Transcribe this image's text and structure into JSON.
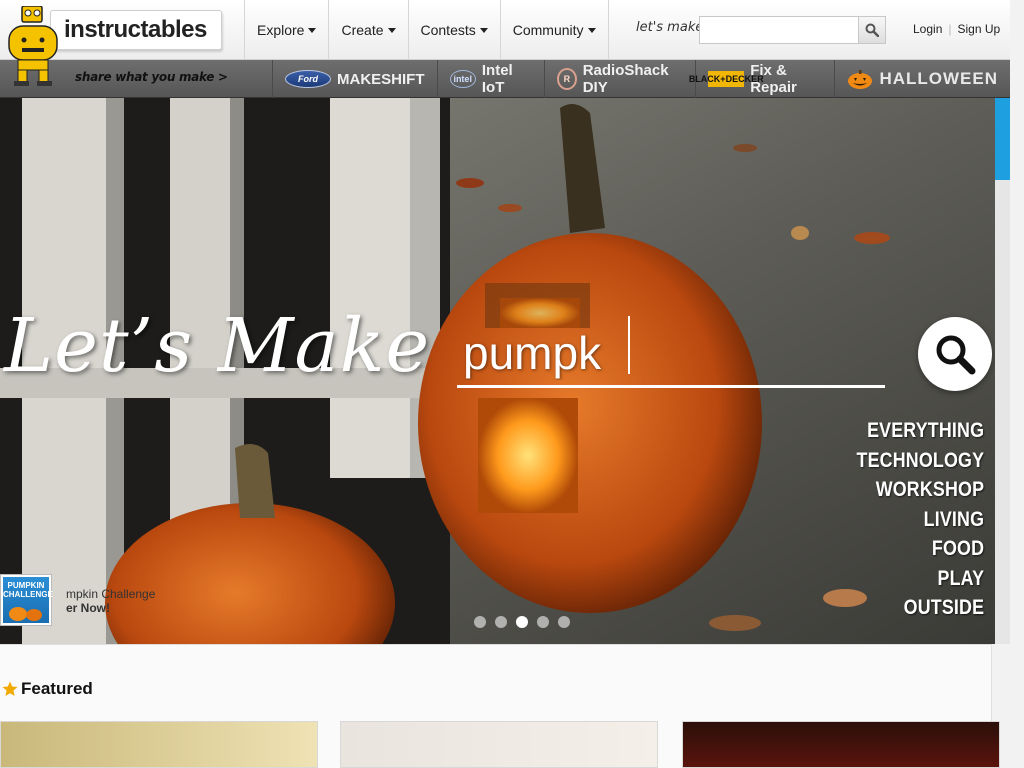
{
  "header": {
    "logo_text": "instructables",
    "tagline": "share what you make >",
    "nav": [
      {
        "label": "Explore"
      },
      {
        "label": "Create"
      },
      {
        "label": "Contests"
      },
      {
        "label": "Community"
      }
    ],
    "search_label": "let's make",
    "search_value": "",
    "login": "Login",
    "signup": "Sign Up"
  },
  "channels": [
    {
      "badge": "Ford",
      "label": "MAKESHIFT"
    },
    {
      "badge": "intel",
      "label": "Intel IoT"
    },
    {
      "badge": "R",
      "label": "RadioShack DIY"
    },
    {
      "badge": "BLACK+DECKER",
      "label": "Fix & Repair"
    },
    {
      "badge": "pumpkin",
      "label": "HALLOWEEN"
    }
  ],
  "hero": {
    "title": "Let’s Make",
    "search_value": "pumpk",
    "categories": [
      "EVERYTHING",
      "TECHNOLOGY",
      "WORKSHOP",
      "LIVING",
      "FOOD",
      "PLAY",
      "OUTSIDE"
    ],
    "contest": {
      "badge_line1": "PUMPKIN",
      "badge_line2": "CHALLENGE",
      "text_line1": "mpkin Challenge",
      "text_line2": "er Now!"
    },
    "carousel_count": 5,
    "carousel_active": 3
  },
  "featured": {
    "label": "Featured"
  },
  "colors": {
    "accent": "#1ea0e0",
    "channel_bar": "#5e5e5e",
    "pumpkin": "#d7641b"
  }
}
